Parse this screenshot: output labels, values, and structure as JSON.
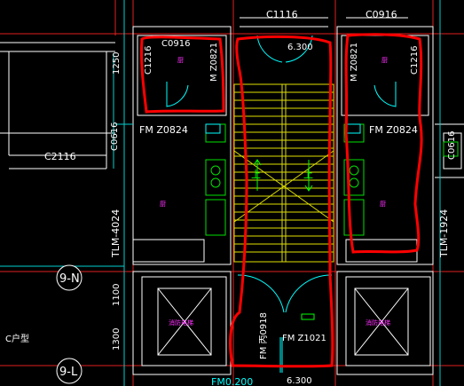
{
  "labels": {
    "window_top_center": "C1116",
    "window_top_right": "C0916",
    "window_room_left": "C0916",
    "window_side_left": "C1216",
    "window_side_right": "C1216",
    "door_left_inner": "M Z0821",
    "door_right_inner": "M Z0821",
    "stair_elev_top": "6.300",
    "dim_left_top": "1250",
    "window_small_left": "C0616",
    "window_small_right": "C0616",
    "window_bottom_left": "C2116",
    "fm_left": "FM Z0824",
    "fm_right": "FM Z0824",
    "tlm_left": "TLM-4024",
    "tlm_right": "TLM-1924",
    "axis_9n": "9-N",
    "axis_9l": "9-L",
    "dim_left_mid": "1100",
    "dim_left_bot": "1300",
    "type_label": "C户型",
    "fm_bottom_left": "FM 丙0918",
    "fm_bottom_right": "FM Z1021",
    "elev_bottom": "6.300",
    "label_bottom_partial": "FM0.200",
    "stair_up_left": "上",
    "stair_up_right": "上",
    "room_small": "厨",
    "elevator_left": "消防电梯",
    "elevator_right": "消防电梯"
  },
  "colors": {
    "background": "#000000",
    "wall": "#ffffff",
    "axis": "#ff2020",
    "markup": "#ff0000",
    "stair": "#ffff00",
    "furniture": "#00ff00",
    "door": "#00ffff",
    "text_room": "#ff30ff"
  }
}
